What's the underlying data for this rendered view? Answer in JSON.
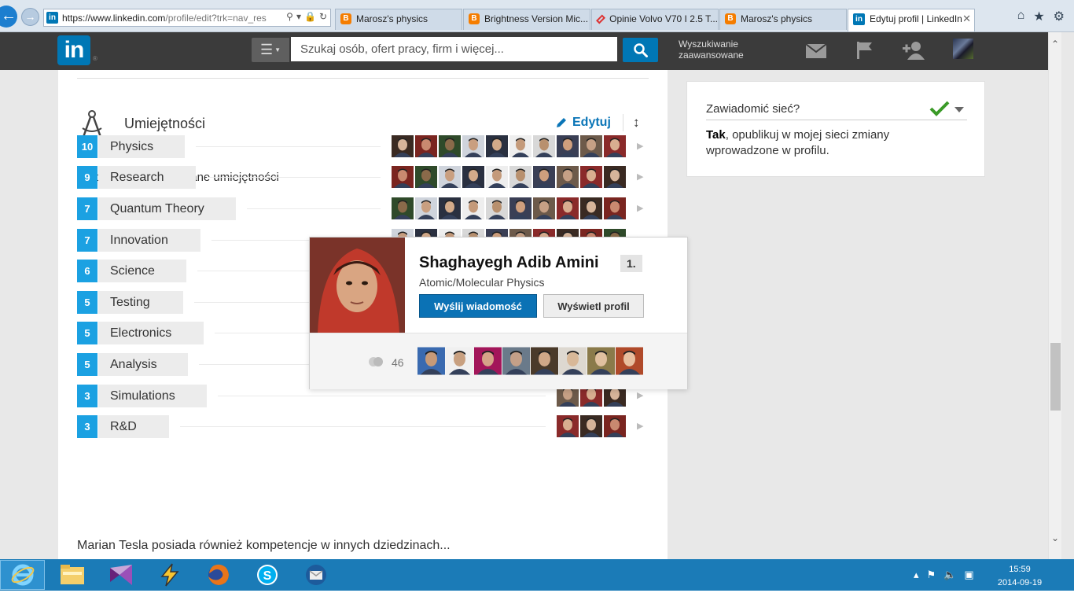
{
  "browser": {
    "url_main": "https://www.linkedin.com",
    "url_rest": "/profile/edit?trk=nav_res",
    "tabs": [
      {
        "label": "Marosz's physics"
      },
      {
        "label": "Brightness Version Mic..."
      },
      {
        "label": "Opinie Volvo V70 I 2.5 T..."
      },
      {
        "label": "Marosz's physics"
      },
      {
        "label": "Edytuj profil | LinkedIn"
      }
    ]
  },
  "header": {
    "logo_text": "in",
    "search_placeholder": "Szukaj osób, ofert pracy, firm i więcej...",
    "advanced_line1": "Wyszukiwanie",
    "advanced_line2": "zaawansowane"
  },
  "skills": {
    "section_title": "Umiejętności",
    "edit_label": "Edytuj",
    "top_label": "Najczęściej potwierdzane umiejętności",
    "items": [
      {
        "count": "10",
        "name": "Physics"
      },
      {
        "count": "9",
        "name": "Research"
      },
      {
        "count": "7",
        "name": "Quantum Theory"
      },
      {
        "count": "7",
        "name": "Innovation"
      },
      {
        "count": "6",
        "name": "Science"
      },
      {
        "count": "5",
        "name": "Testing"
      },
      {
        "count": "5",
        "name": "Electronics"
      },
      {
        "count": "5",
        "name": "Analysis"
      },
      {
        "count": "3",
        "name": "Simulations"
      },
      {
        "count": "3",
        "name": "R&D"
      }
    ],
    "more_label": "Marian Tesla posiada również kompetencje w innych dziedzinach..."
  },
  "notify": {
    "label": "Zawiadomić sieć?",
    "text_bold": "Tak",
    "text_rest": ", opublikuj w mojej sieci zmiany wprowadzone w profilu."
  },
  "popup": {
    "name": "Shaghayegh Adib Amini",
    "degree": "1.",
    "headline": "Atomic/Molecular Physics",
    "message_label": "Wyślij wiadomość",
    "profile_label": "Wyświetl profil",
    "connections": "46"
  },
  "taskbar": {
    "time": "15:59",
    "date": "2014-09-19"
  },
  "colors": {
    "linkedin_blue": "#0077b5",
    "skill_badge": "#1ba1e2",
    "header_dark": "#3b3b3b",
    "taskbar": "#1b7bb7"
  }
}
